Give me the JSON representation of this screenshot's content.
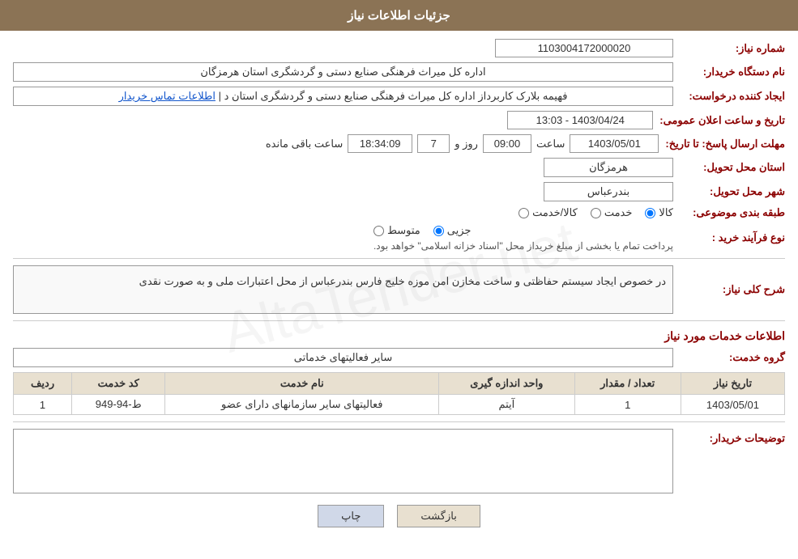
{
  "page": {
    "title": "جزئیات اطلاعات نیاز"
  },
  "header": {
    "title": "جزئیات اطلاعات نیاز"
  },
  "fields": {
    "shomareNiaz_label": "شماره نیاز:",
    "shomareNiaz_value": "1103004172000020",
    "namdastgah_label": "نام دستگاه خریدار:",
    "namdastgah_value": "اداره کل میراث فرهنگی  صنایع دستی و گردشگری استان هرمزگان",
    "ijadkonande_label": "ایجاد کننده درخواست:",
    "ijadkonande_value": "فهیمه بلارک کاربرداز اداره کل میراث فرهنگی  صنایع دستی و گردشگری استان د",
    "ijadkonande_link": "اطلاعات تماس خریدار",
    "tarhkh_label": "تاریخ و ساعت اعلان عمومی:",
    "tarikh_value": "1403/04/24 - 13:03",
    "mohlat_label": "مهلت ارسال پاسخ: تا تاریخ:",
    "date_value": "1403/05/01",
    "saat_label": "ساعت",
    "saat_value": "09:00",
    "roz_label": "روز و",
    "roz_value": "7",
    "baqi_label": "ساعت باقی مانده",
    "baqi_value": "18:34:09",
    "ostan_label": "استان محل تحویل:",
    "ostan_value": "هرمزگان",
    "shahr_label": "شهر محل تحویل:",
    "shahr_value": "بندرعباس",
    "tabaqe_label": "طبقه بندی موضوعی:",
    "radio_kala": "کالا",
    "radio_khedmat": "خدمت",
    "radio_kala_khedmat": "کالا/خدمت",
    "noeFarayand_label": "نوع فرآیند خرید :",
    "radio_jozi": "جزیی",
    "radio_motevaset": "متوسط",
    "noeFarayand_note": "پرداخت تمام یا بخشی از مبلغ خریداز محل \"اسناد خزانه اسلامی\" خواهد بود.",
    "sharh_label": "شرح کلی نیاز:",
    "sharh_value": "در خصوص ایجاد سیستم حفاظتی و ساخت مخازن امن موزه خلیج فارس بندرعباس از محل اعتبارات ملی و به صورت نقدی",
    "khadamat_label": "اطلاعات خدمات مورد نیاز",
    "grohe_khadamat_label": "گروه خدمت:",
    "grohe_khadamat_value": "سایر فعالیتهای خدماتی",
    "table_headers": {
      "radif": "ردیف",
      "kodKhadamat": "کد خدمت",
      "namKhadamat": "نام خدمت",
      "vahed": "واحد اندازه گیری",
      "tedad": "تعداد / مقدار",
      "tarikh": "تاریخ نیاز"
    },
    "table_rows": [
      {
        "radif": "1",
        "kodKhadamat": "ط-94-949",
        "namKhadamat": "فعالیتهای سایر سازمانهای دارای عضو",
        "vahed": "آیتم",
        "tedad": "1",
        "tarikh": "1403/05/01"
      }
    ],
    "tosifat_label": "توضیحات خریدار:",
    "tosifat_placeholder": ""
  },
  "buttons": {
    "print": "چاپ",
    "back": "بازگشت"
  }
}
